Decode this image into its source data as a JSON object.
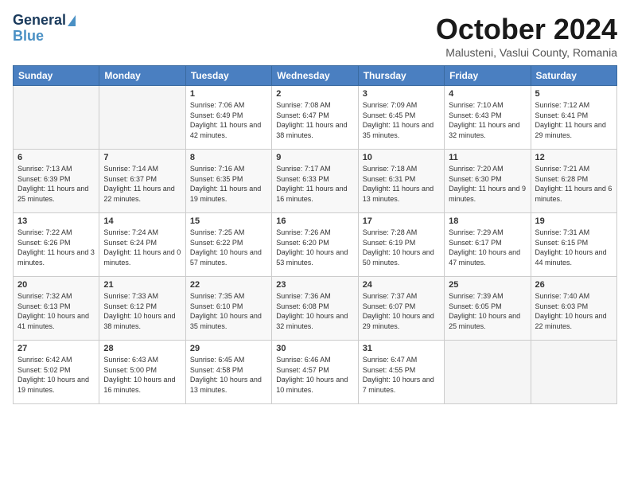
{
  "header": {
    "logo_line1": "General",
    "logo_line2": "Blue",
    "month_title": "October 2024",
    "location": "Malusteni, Vaslui County, Romania"
  },
  "days_of_week": [
    "Sunday",
    "Monday",
    "Tuesday",
    "Wednesday",
    "Thursday",
    "Friday",
    "Saturday"
  ],
  "weeks": [
    [
      {
        "day": "",
        "empty": true
      },
      {
        "day": "",
        "empty": true
      },
      {
        "day": "1",
        "sunrise": "7:06 AM",
        "sunset": "6:49 PM",
        "daylight": "11 hours and 42 minutes."
      },
      {
        "day": "2",
        "sunrise": "7:08 AM",
        "sunset": "6:47 PM",
        "daylight": "11 hours and 38 minutes."
      },
      {
        "day": "3",
        "sunrise": "7:09 AM",
        "sunset": "6:45 PM",
        "daylight": "11 hours and 35 minutes."
      },
      {
        "day": "4",
        "sunrise": "7:10 AM",
        "sunset": "6:43 PM",
        "daylight": "11 hours and 32 minutes."
      },
      {
        "day": "5",
        "sunrise": "7:12 AM",
        "sunset": "6:41 PM",
        "daylight": "11 hours and 29 minutes."
      }
    ],
    [
      {
        "day": "6",
        "sunrise": "7:13 AM",
        "sunset": "6:39 PM",
        "daylight": "11 hours and 25 minutes."
      },
      {
        "day": "7",
        "sunrise": "7:14 AM",
        "sunset": "6:37 PM",
        "daylight": "11 hours and 22 minutes."
      },
      {
        "day": "8",
        "sunrise": "7:16 AM",
        "sunset": "6:35 PM",
        "daylight": "11 hours and 19 minutes."
      },
      {
        "day": "9",
        "sunrise": "7:17 AM",
        "sunset": "6:33 PM",
        "daylight": "11 hours and 16 minutes."
      },
      {
        "day": "10",
        "sunrise": "7:18 AM",
        "sunset": "6:31 PM",
        "daylight": "11 hours and 13 minutes."
      },
      {
        "day": "11",
        "sunrise": "7:20 AM",
        "sunset": "6:30 PM",
        "daylight": "11 hours and 9 minutes."
      },
      {
        "day": "12",
        "sunrise": "7:21 AM",
        "sunset": "6:28 PM",
        "daylight": "11 hours and 6 minutes."
      }
    ],
    [
      {
        "day": "13",
        "sunrise": "7:22 AM",
        "sunset": "6:26 PM",
        "daylight": "11 hours and 3 minutes."
      },
      {
        "day": "14",
        "sunrise": "7:24 AM",
        "sunset": "6:24 PM",
        "daylight": "11 hours and 0 minutes."
      },
      {
        "day": "15",
        "sunrise": "7:25 AM",
        "sunset": "6:22 PM",
        "daylight": "10 hours and 57 minutes."
      },
      {
        "day": "16",
        "sunrise": "7:26 AM",
        "sunset": "6:20 PM",
        "daylight": "10 hours and 53 minutes."
      },
      {
        "day": "17",
        "sunrise": "7:28 AM",
        "sunset": "6:19 PM",
        "daylight": "10 hours and 50 minutes."
      },
      {
        "day": "18",
        "sunrise": "7:29 AM",
        "sunset": "6:17 PM",
        "daylight": "10 hours and 47 minutes."
      },
      {
        "day": "19",
        "sunrise": "7:31 AM",
        "sunset": "6:15 PM",
        "daylight": "10 hours and 44 minutes."
      }
    ],
    [
      {
        "day": "20",
        "sunrise": "7:32 AM",
        "sunset": "6:13 PM",
        "daylight": "10 hours and 41 minutes."
      },
      {
        "day": "21",
        "sunrise": "7:33 AM",
        "sunset": "6:12 PM",
        "daylight": "10 hours and 38 minutes."
      },
      {
        "day": "22",
        "sunrise": "7:35 AM",
        "sunset": "6:10 PM",
        "daylight": "10 hours and 35 minutes."
      },
      {
        "day": "23",
        "sunrise": "7:36 AM",
        "sunset": "6:08 PM",
        "daylight": "10 hours and 32 minutes."
      },
      {
        "day": "24",
        "sunrise": "7:37 AM",
        "sunset": "6:07 PM",
        "daylight": "10 hours and 29 minutes."
      },
      {
        "day": "25",
        "sunrise": "7:39 AM",
        "sunset": "6:05 PM",
        "daylight": "10 hours and 25 minutes."
      },
      {
        "day": "26",
        "sunrise": "7:40 AM",
        "sunset": "6:03 PM",
        "daylight": "10 hours and 22 minutes."
      }
    ],
    [
      {
        "day": "27",
        "sunrise": "6:42 AM",
        "sunset": "5:02 PM",
        "daylight": "10 hours and 19 minutes."
      },
      {
        "day": "28",
        "sunrise": "6:43 AM",
        "sunset": "5:00 PM",
        "daylight": "10 hours and 16 minutes."
      },
      {
        "day": "29",
        "sunrise": "6:45 AM",
        "sunset": "4:58 PM",
        "daylight": "10 hours and 13 minutes."
      },
      {
        "day": "30",
        "sunrise": "6:46 AM",
        "sunset": "4:57 PM",
        "daylight": "10 hours and 10 minutes."
      },
      {
        "day": "31",
        "sunrise": "6:47 AM",
        "sunset": "4:55 PM",
        "daylight": "10 hours and 7 minutes."
      },
      {
        "day": "",
        "empty": true
      },
      {
        "day": "",
        "empty": true
      }
    ]
  ]
}
